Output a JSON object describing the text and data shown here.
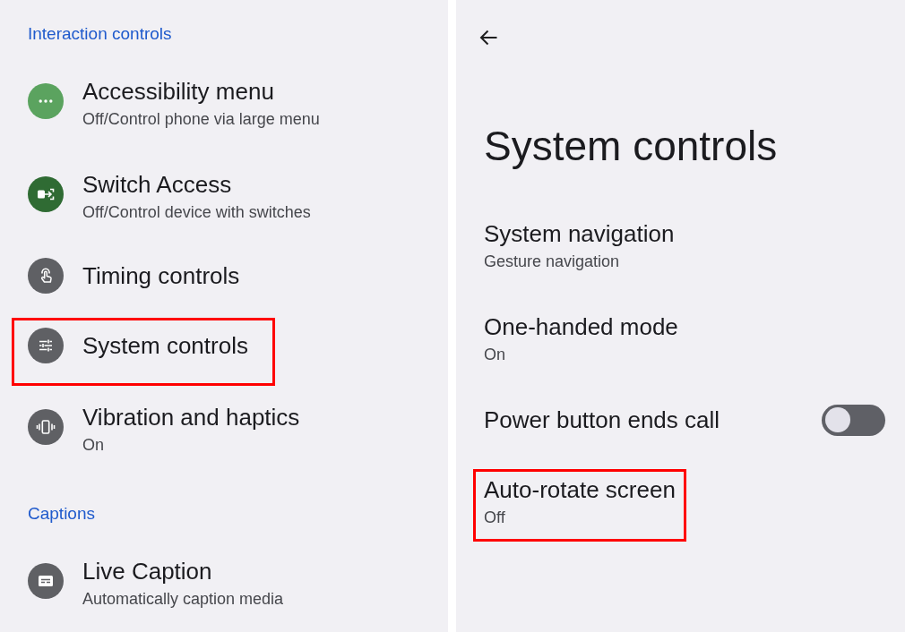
{
  "left_panel": {
    "sections": [
      {
        "header": "Interaction controls",
        "items": [
          {
            "title": "Accessibility menu",
            "subtitle": "Off/Control phone via large menu",
            "color": "#5ba35f",
            "highlighted": false
          },
          {
            "title": "Switch Access",
            "subtitle": "Off/Control device with switches",
            "color": "#2f6b33",
            "highlighted": false
          },
          {
            "title": "Timing controls",
            "color": "#5f6064",
            "highlighted": false
          },
          {
            "title": "System controls",
            "color": "#5f6064",
            "highlighted": true
          },
          {
            "title": "Vibration and haptics",
            "subtitle": "On",
            "color": "#5f6064",
            "highlighted": false
          }
        ]
      },
      {
        "header": "Captions",
        "items": [
          {
            "title": "Live Caption",
            "subtitle": "Automatically caption media",
            "color": "#5f6064",
            "highlighted": false
          }
        ]
      }
    ]
  },
  "right_panel": {
    "title": "System controls",
    "items": [
      {
        "kind": "link",
        "title": "System navigation",
        "subtitle": "Gesture navigation",
        "highlighted": false
      },
      {
        "kind": "link",
        "title": "One-handed mode",
        "subtitle": "On",
        "highlighted": false
      },
      {
        "kind": "toggle",
        "title": "Power button ends call",
        "on": false,
        "highlighted": false
      },
      {
        "kind": "link",
        "title": "Auto-rotate screen",
        "subtitle": "Off",
        "highlighted": true
      }
    ]
  }
}
